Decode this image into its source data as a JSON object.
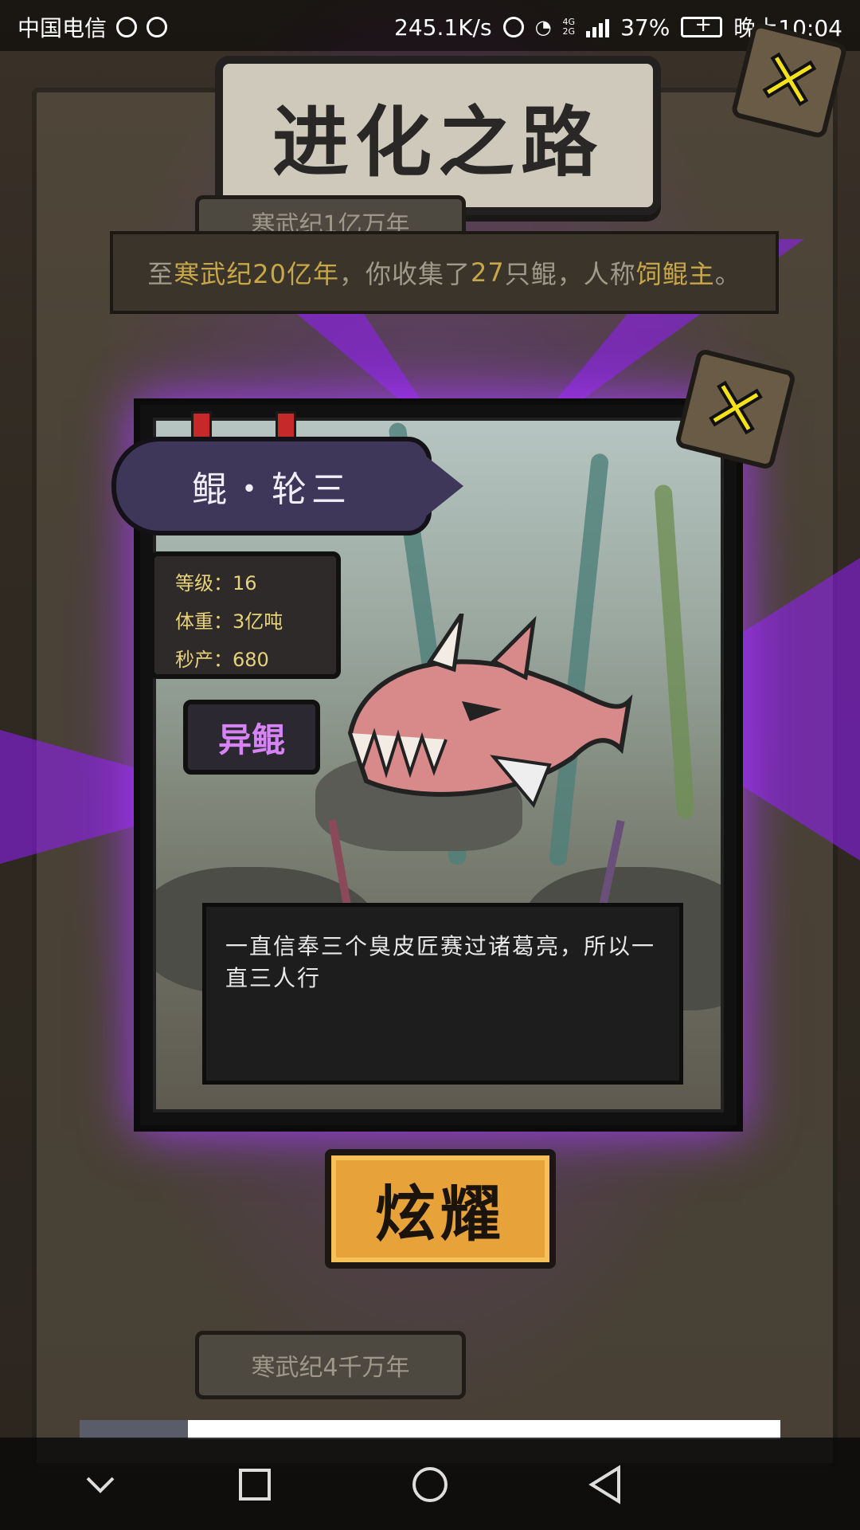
{
  "status_bar": {
    "carrier": "中国电信",
    "net_speed": "245.1K/s",
    "network_type": "4G\n2G",
    "battery": "37%",
    "time": "晚上10:04"
  },
  "header": {
    "title": "进化之路",
    "close_icon": "close-x-icon"
  },
  "era_tabs": {
    "top": "寒武纪1亿万年",
    "bottom": "寒武纪4千万年"
  },
  "summary": {
    "prefix": "至",
    "era": "寒武纪20亿年",
    "middle": "，你收集了",
    "count": "27",
    "suffix": "只鲲，人称",
    "title": "饲鲲主",
    "end": "。"
  },
  "card": {
    "name": "鲲・轮三",
    "stats": {
      "level_label": "等级：",
      "level_value": "16",
      "weight_label": "体重：",
      "weight_value": "3亿吨",
      "output_label": "秒产：",
      "output_value": "680"
    },
    "rarity": "异鲲",
    "description": "一直信奉三个臭皮匠赛过诸葛亮，所以一直三人行"
  },
  "actions": {
    "show_off": "炫耀"
  },
  "nav_bar": {
    "items": [
      "collapse-icon",
      "recents-icon",
      "home-icon",
      "back-icon"
    ]
  },
  "colors": {
    "glow": "#a020ff",
    "highlight": "#c8a748",
    "rarity": "#d684f5",
    "button": "#e8a23a"
  }
}
